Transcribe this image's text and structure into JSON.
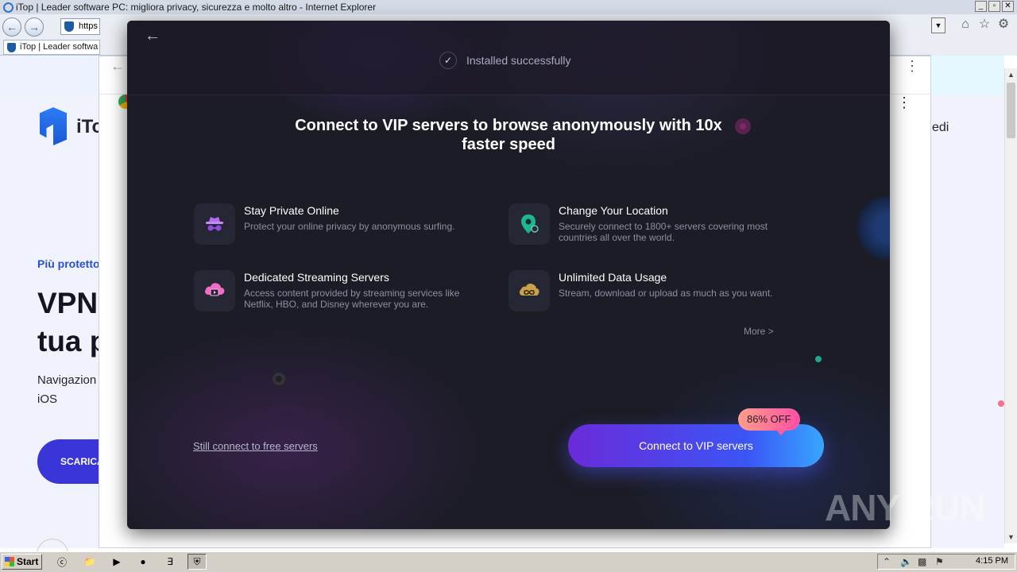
{
  "window": {
    "title": "iTop | Leader software PC: migliora privacy, sicurezza e molto altro - Internet Explorer",
    "controls": [
      "_",
      "▫",
      "✕"
    ]
  },
  "ie": {
    "address_text": "https",
    "tab_label": "iTop | Leader softwa",
    "dropdown": "▼"
  },
  "site": {
    "brand": "iTo",
    "right_nav_text": "edi",
    "kicker": "Più protetto",
    "headline": "VPN tua p",
    "paragraph": "Navigazion Mac e iOS",
    "cta_label": "SCARICA"
  },
  "dialog": {
    "back_arrow": "←",
    "installed_text": "Installed successfully",
    "headline": "Connect to VIP servers to browse anonymously with 10x faster speed",
    "features": [
      {
        "title": "Stay Private Online",
        "desc": "Protect your online privacy by anonymous surfing.",
        "icon": "incognito-icon"
      },
      {
        "title": "Change Your Location",
        "desc": "Securely connect to 1800+ servers covering most countries all over the world.",
        "icon": "location-pin-icon"
      },
      {
        "title": "Dedicated Streaming Servers",
        "desc": "Access content provided by streaming services like Netflix, HBO, and Disney wherever you are.",
        "icon": "streaming-cloud-icon"
      },
      {
        "title": "Unlimited Data Usage",
        "desc": "Stream, download or upload as much as you want.",
        "icon": "infinity-cloud-icon"
      }
    ],
    "more_label": "More >",
    "free_link": "Still connect to free servers",
    "vip_button": "Connect to VIP servers",
    "badge": "86% OFF"
  },
  "taskbar": {
    "start_label": "Start",
    "clock": "4:15 PM"
  },
  "watermark": "ANY RUN"
}
